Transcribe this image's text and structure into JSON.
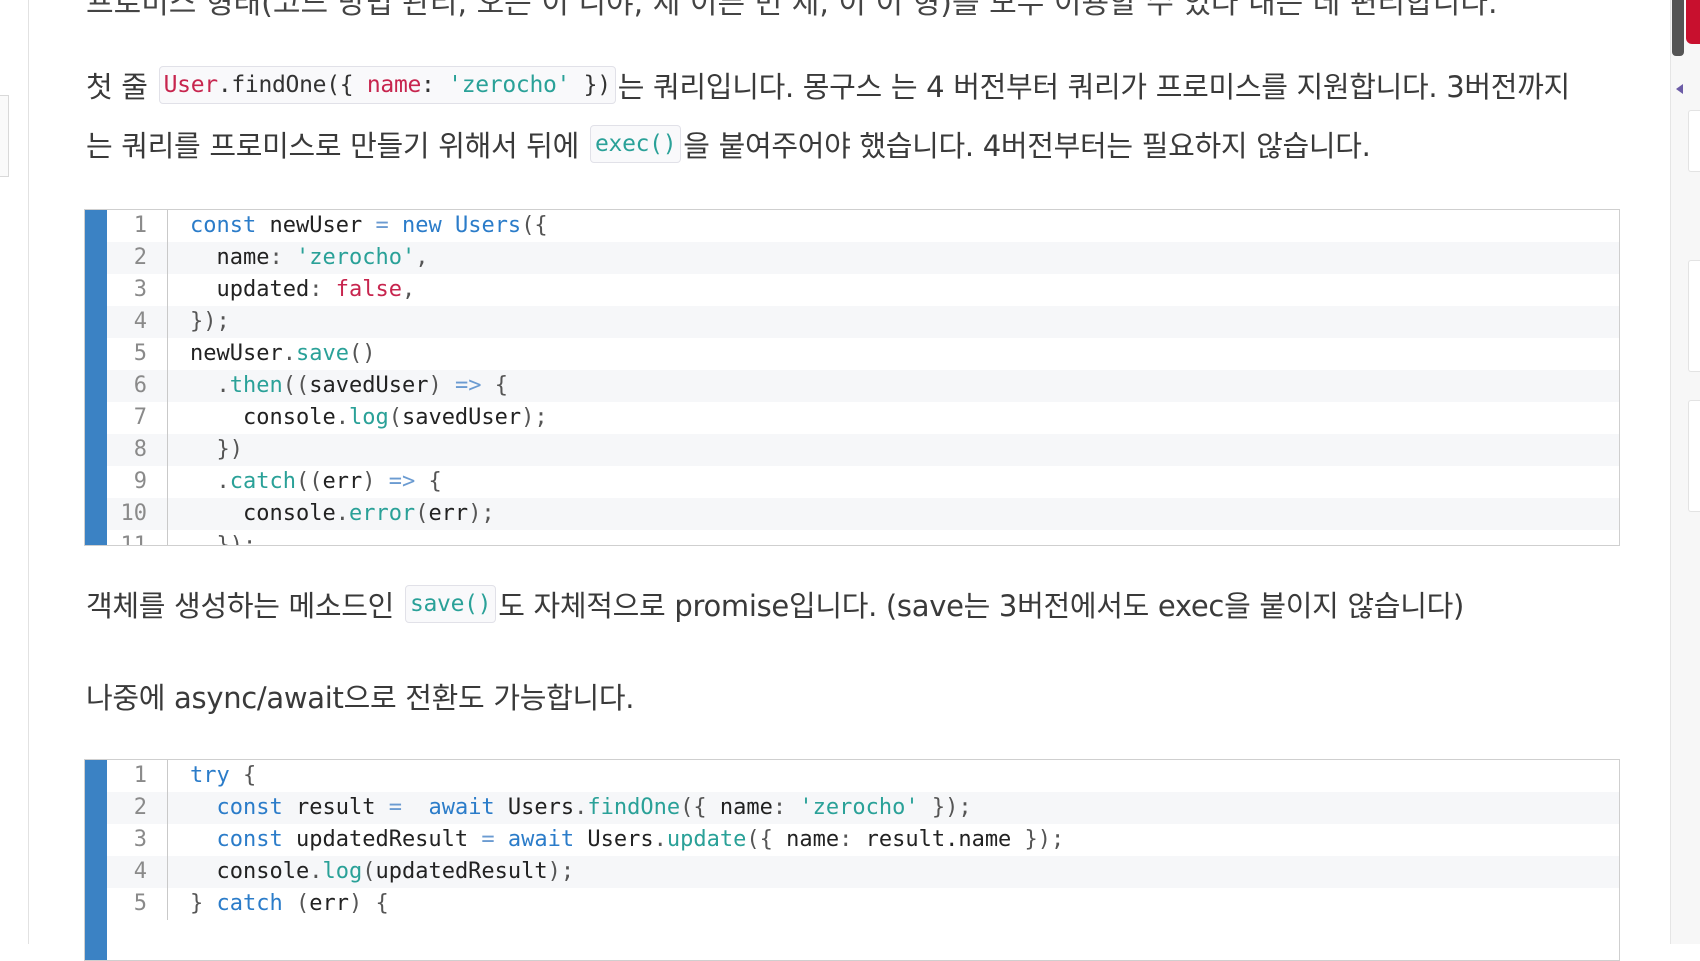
{
  "top_partial_text": "프로미스 형태(코드 방법 관리, 오는 이 니야, 세 이른 번 세, 이 이 형)를 모두 이용할 수 있다 내는 데 편리합니다.",
  "para1": {
    "prefix": "첫 줄 ",
    "code_obj": "User",
    "code_dot1": ".findOne({ ",
    "code_key": "name",
    "code_colon": ": ",
    "code_str": "'zerocho'",
    "code_close": " })",
    "suffix": "는 쿼리입니다. 몽구스 는 4 버전부터 쿼리가 프로미스를 지원합니다. 3버전까지"
  },
  "para2": {
    "prefix": "는 쿼리를 프로미스로 만들기 위해서 뒤에 ",
    "code": "exec()",
    "suffix": "을 붙여주어야 했습니다. 4버전부터는 필요하지 않습니다."
  },
  "code_block_1": [
    [
      [
        "kw",
        "const"
      ],
      [
        "n",
        " newUser "
      ],
      [
        "op",
        "="
      ],
      [
        "n",
        " "
      ],
      [
        "kw",
        "new"
      ],
      [
        "n",
        " "
      ],
      [
        "kw",
        "Users"
      ],
      [
        "p",
        "({"
      ]
    ],
    [
      [
        "n",
        "  name"
      ],
      [
        "p",
        ": "
      ],
      [
        "str",
        "'zerocho'"
      ],
      [
        "p",
        ","
      ]
    ],
    [
      [
        "n",
        "  updated"
      ],
      [
        "p",
        ": "
      ],
      [
        "bool",
        "false"
      ],
      [
        "p",
        ","
      ]
    ],
    [
      [
        "p",
        "});"
      ]
    ],
    [
      [
        "n",
        "newUser"
      ],
      [
        "p",
        "."
      ],
      [
        "fn",
        "save"
      ],
      [
        "p",
        "()"
      ]
    ],
    [
      [
        "n",
        "  "
      ],
      [
        "p",
        "."
      ],
      [
        "fn",
        "then"
      ],
      [
        "p",
        "(("
      ],
      [
        "n",
        "savedUser"
      ],
      [
        "p",
        ") "
      ],
      [
        "op",
        "=>"
      ],
      [
        "p",
        " {"
      ]
    ],
    [
      [
        "n",
        "    console"
      ],
      [
        "p",
        "."
      ],
      [
        "fn",
        "log"
      ],
      [
        "p",
        "("
      ],
      [
        "n",
        "savedUser"
      ],
      [
        "p",
        ");"
      ]
    ],
    [
      [
        "p",
        "  })"
      ]
    ],
    [
      [
        "n",
        "  "
      ],
      [
        "p",
        "."
      ],
      [
        "fn",
        "catch"
      ],
      [
        "p",
        "(("
      ],
      [
        "n",
        "err"
      ],
      [
        "p",
        ") "
      ],
      [
        "op",
        "=>"
      ],
      [
        "p",
        " {"
      ]
    ],
    [
      [
        "n",
        "    console"
      ],
      [
        "p",
        "."
      ],
      [
        "fn",
        "error"
      ],
      [
        "p",
        "("
      ],
      [
        "n",
        "err"
      ],
      [
        "p",
        ");"
      ]
    ],
    [
      [
        "p",
        "  });"
      ]
    ]
  ],
  "para3": {
    "prefix": "객체를 생성하는 메소드인 ",
    "code": "save()",
    "suffix": "도 자체적으로 promise입니다. (save는 3버전에서도 exec을 붙이지 않습니다)"
  },
  "para4": "나중에 async/await으로 전환도 가능합니다.",
  "code_block_2": [
    [
      [
        "kw",
        "try"
      ],
      [
        "p",
        " {"
      ]
    ],
    [
      [
        "n",
        "  "
      ],
      [
        "kw",
        "const"
      ],
      [
        "n",
        " result "
      ],
      [
        "op",
        "="
      ],
      [
        "n",
        "  "
      ],
      [
        "kw",
        "await"
      ],
      [
        "n",
        " Users"
      ],
      [
        "p",
        "."
      ],
      [
        "fn",
        "findOne"
      ],
      [
        "p",
        "({ "
      ],
      [
        "n",
        "name"
      ],
      [
        "p",
        ": "
      ],
      [
        "str",
        "'zerocho'"
      ],
      [
        "p",
        " });"
      ]
    ],
    [
      [
        "n",
        "  "
      ],
      [
        "kw",
        "const"
      ],
      [
        "n",
        " updatedResult "
      ],
      [
        "op",
        "="
      ],
      [
        "n",
        " "
      ],
      [
        "kw",
        "await"
      ],
      [
        "n",
        " Users"
      ],
      [
        "p",
        "."
      ],
      [
        "fn",
        "update"
      ],
      [
        "p",
        "({ "
      ],
      [
        "n",
        "name"
      ],
      [
        "p",
        ": "
      ],
      [
        "n",
        "result.name"
      ],
      [
        "p",
        " });"
      ]
    ],
    [
      [
        "n",
        "  console"
      ],
      [
        "p",
        "."
      ],
      [
        "fn",
        "log"
      ],
      [
        "p",
        "("
      ],
      [
        "n",
        "updatedResult"
      ],
      [
        "p",
        ");"
      ]
    ],
    [
      [
        "p",
        "} "
      ],
      [
        "kw",
        "catch"
      ],
      [
        "p",
        " ("
      ],
      [
        "n",
        "err"
      ],
      [
        "p",
        ") {"
      ]
    ]
  ],
  "colors": {
    "accent_bar": "#3b82c4",
    "keyword": "#2b7cc9",
    "string": "#2aa198",
    "literal": "#c7254e"
  }
}
